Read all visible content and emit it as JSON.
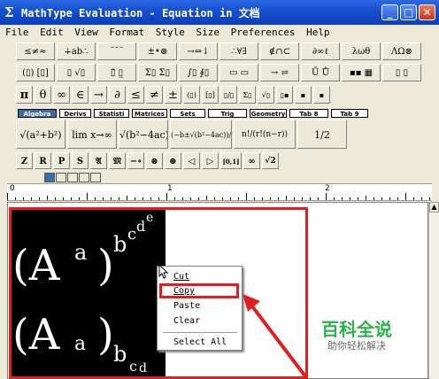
{
  "window": {
    "title": "MathType Evaluation - Equation in 文档",
    "minimize": "_",
    "maximize": "□",
    "close": "✕"
  },
  "menu": [
    "File",
    "Edit",
    "View",
    "Format",
    "Style",
    "Size",
    "Preferences",
    "Help"
  ],
  "toolbar_row1": [
    "≤≠≈",
    "∔ab∴",
    "˘˘˘",
    "±•⊗",
    "→⇔↓",
    "∴∀∃",
    "∉∩⊂",
    "∂∞ℓ",
    "λωθ",
    "ΛΩ⊗"
  ],
  "toolbar_row2": [
    "(▯) [▯]",
    "▯ √▯",
    "▯̈ ▯̲",
    "Σ▯ Σ▯",
    "∫▯ ∮▯",
    "▭ ▭",
    "→ ⇌",
    "Ũ Ů",
    "▪▪ ▦",
    "▯ ▯"
  ],
  "toolbar_row3": [
    "π",
    "θ",
    "∞",
    "∈",
    "→",
    "∂",
    "≤",
    "≠",
    "±",
    "(▯)",
    "[▯]",
    "▯/▯",
    "Σ▯",
    "√▯",
    "▯▪",
    "▪",
    "▪"
  ],
  "tabs": [
    "Algebra",
    "Derivs",
    "Statisti",
    "Matrices",
    "Sets",
    "Trig",
    "Geometry",
    "Tab 8",
    "Tab 9"
  ],
  "templates": [
    "√(a²+b²)",
    "lim x→∞",
    "√(b²−4ac)",
    "(−b±√(b²−4ac))/2a",
    "n!/(r!(n−r))",
    "1/2"
  ],
  "small_row": [
    "Z",
    "R",
    "P",
    "S",
    "𝔄",
    "𝔐",
    "−∘",
    "⊗",
    "⊕",
    "◁",
    "▷",
    "[0,1]",
    "∞",
    "√2"
  ],
  "ruler_labels": [
    "0",
    "1",
    "2"
  ],
  "equations": {
    "eq1_base": "(A",
    "eq1_sup_a": "a",
    "eq1_close": ")",
    "eq1_b": "b",
    "eq1_c": "c",
    "eq1_d": "d",
    "eq1_e": "e",
    "eq2_base": "(A",
    "eq2_sub_a": "a",
    "eq2_close": ")",
    "eq2_b": "b",
    "eq2_c": "c",
    "eq2_d": "d"
  },
  "context_menu": {
    "cut": "Cut",
    "copy": "Copy",
    "paste": "Paste",
    "clear": "Clear",
    "select_all": "Select All"
  },
  "watermark": {
    "title": "百科全说",
    "subtitle": "助你轻松解决"
  },
  "colors": {
    "highlight": "#e02020",
    "titlebar": "#1650d0",
    "watermark": "#2bb24c"
  }
}
